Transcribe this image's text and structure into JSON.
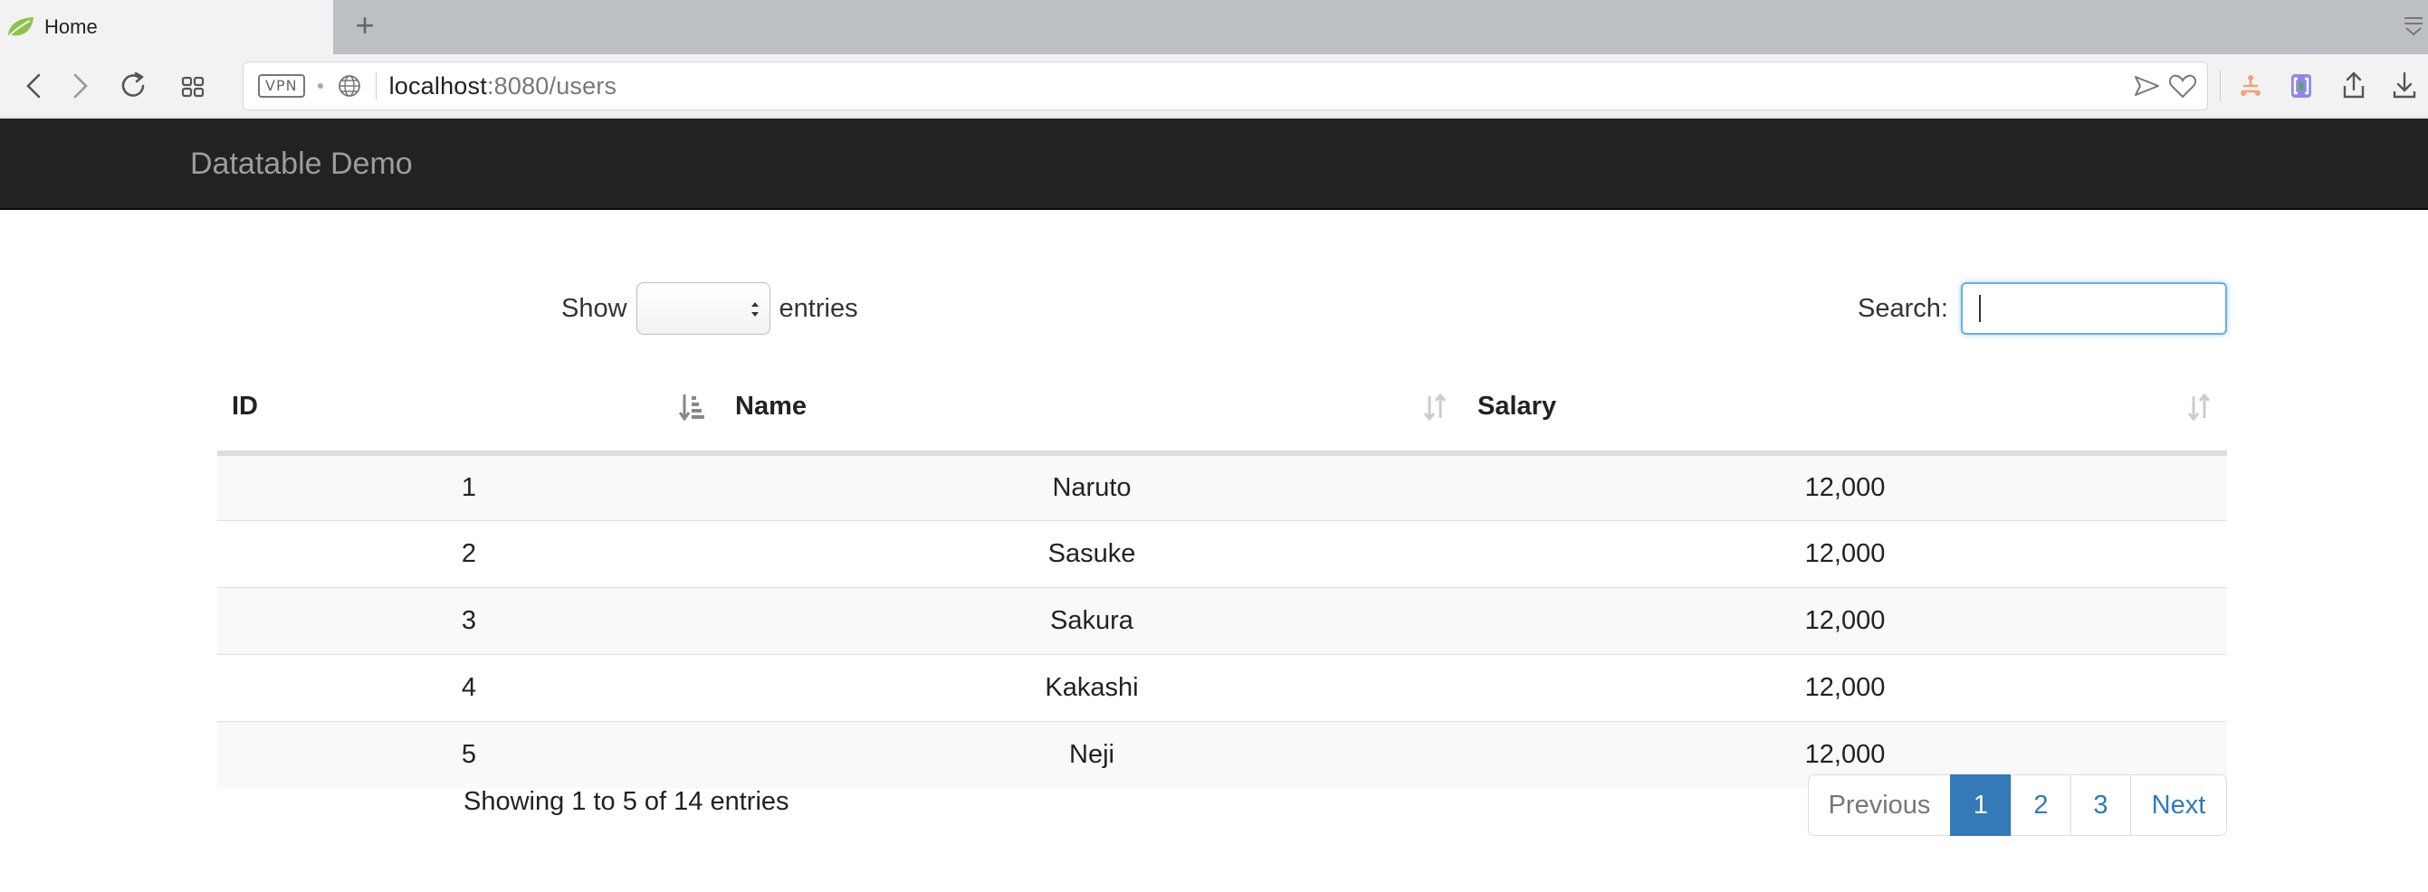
{
  "browser": {
    "tab_title": "Home",
    "new_tab_label": "+",
    "vpn_label": "VPN",
    "url_host": "localhost",
    "url_rest": ":8080/users"
  },
  "navbar": {
    "brand": "Datatable Demo"
  },
  "datatable": {
    "length_label_before": "Show",
    "length_label_after": "entries",
    "length_selected": "",
    "search_label": "Search:",
    "search_value": "",
    "columns": [
      "ID",
      "Name",
      "Salary"
    ],
    "rows": [
      {
        "id": "1",
        "name": "Naruto",
        "salary": "12,000"
      },
      {
        "id": "2",
        "name": "Sasuke",
        "salary": "12,000"
      },
      {
        "id": "3",
        "name": "Sakura",
        "salary": "12,000"
      },
      {
        "id": "4",
        "name": "Kakashi",
        "salary": "12,000"
      },
      {
        "id": "5",
        "name": "Neji",
        "salary": "12,000"
      }
    ],
    "info": "Showing 1 to 5 of 14 entries",
    "pagination": {
      "previous": "Previous",
      "pages": [
        "1",
        "2",
        "3"
      ],
      "current": "1",
      "next": "Next"
    }
  },
  "colors": {
    "navbar_bg": "#222222",
    "brand_text": "#9d9d9d",
    "link": "#337ab7",
    "active_page_bg": "#337ab7",
    "stripe": "#f9f9f9",
    "focus_border": "#66afe9"
  },
  "icons": [
    "spring-leaf-icon",
    "plus-icon",
    "tab-menu-icon",
    "back-icon",
    "forward-icon",
    "reload-icon",
    "grid-icon",
    "globe-icon",
    "send-icon",
    "heart-icon",
    "extension-icon",
    "bracket-icon",
    "share-icon",
    "download-icon",
    "sort-asc-icon",
    "sort-both-icon",
    "select-arrows-icon"
  ]
}
